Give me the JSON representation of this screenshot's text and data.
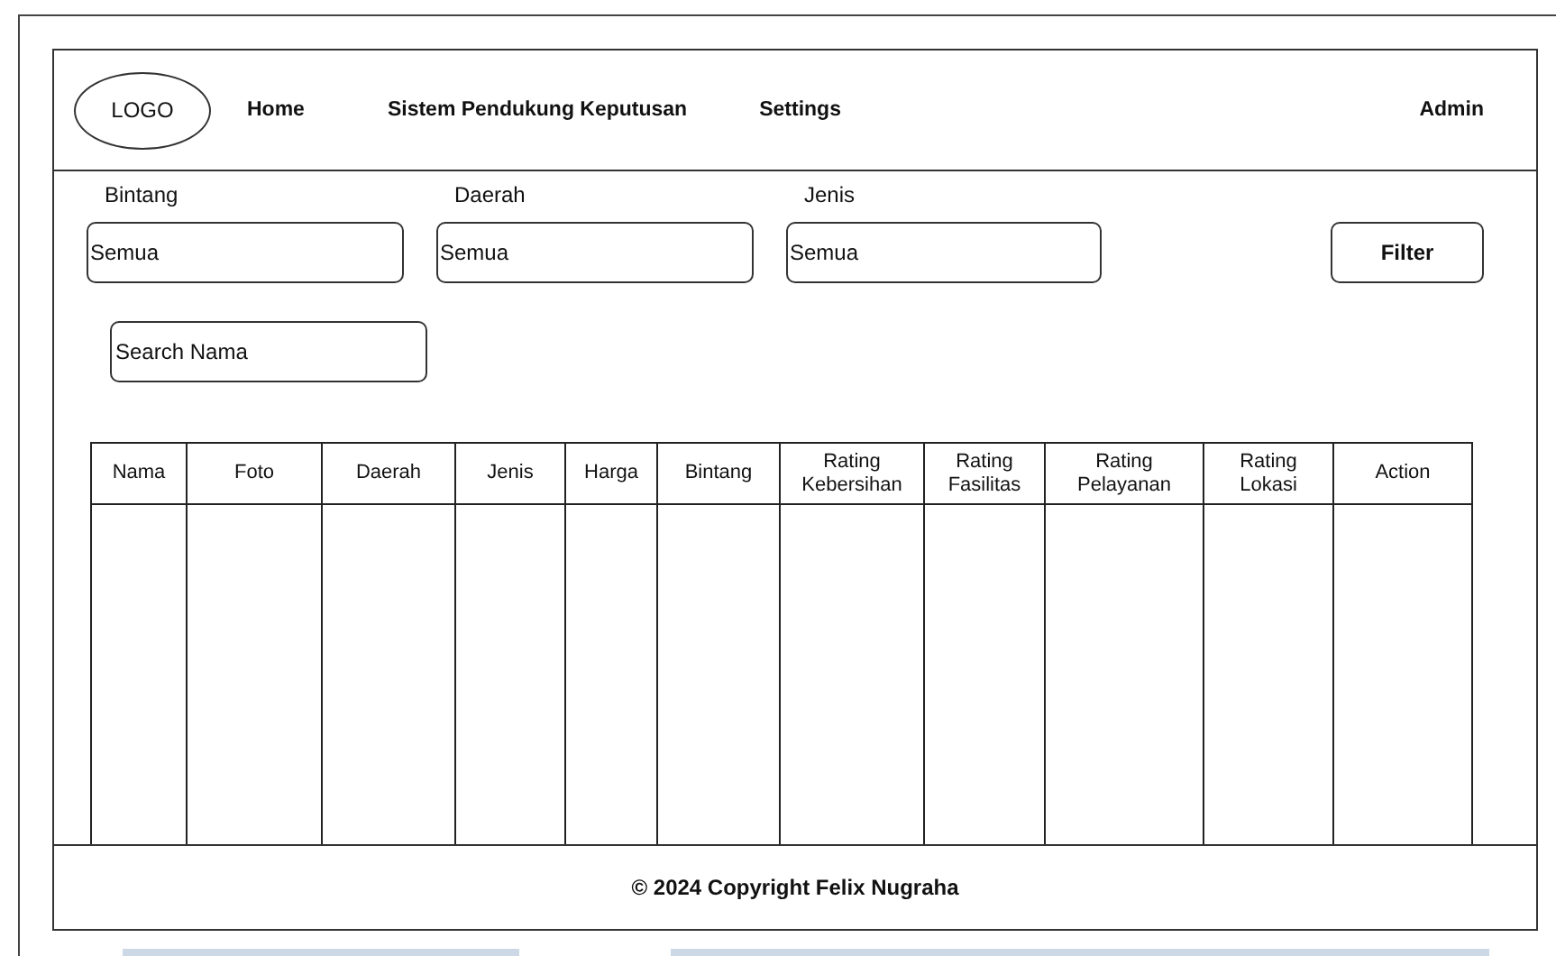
{
  "header": {
    "logo": "LOGO",
    "nav": [
      "Home",
      "Sistem Pendukung Keputusan",
      "Settings"
    ],
    "user": "Admin"
  },
  "filters": [
    {
      "label": "Bintang",
      "value": "Semua"
    },
    {
      "label": "Daerah",
      "value": "Semua"
    },
    {
      "label": "Jenis",
      "value": "Semua"
    }
  ],
  "filter_button": "Filter",
  "search": {
    "placeholder": "Search Nama"
  },
  "table": {
    "columns": [
      "Nama",
      "Foto",
      "Daerah",
      "Jenis",
      "Harga",
      "Bintang",
      "Rating Kebersihan",
      "Rating Fasilitas",
      "Rating Pelayanan",
      "Rating Lokasi",
      "Action"
    ]
  },
  "footer": "© 2024 Copyright Felix Nugraha"
}
